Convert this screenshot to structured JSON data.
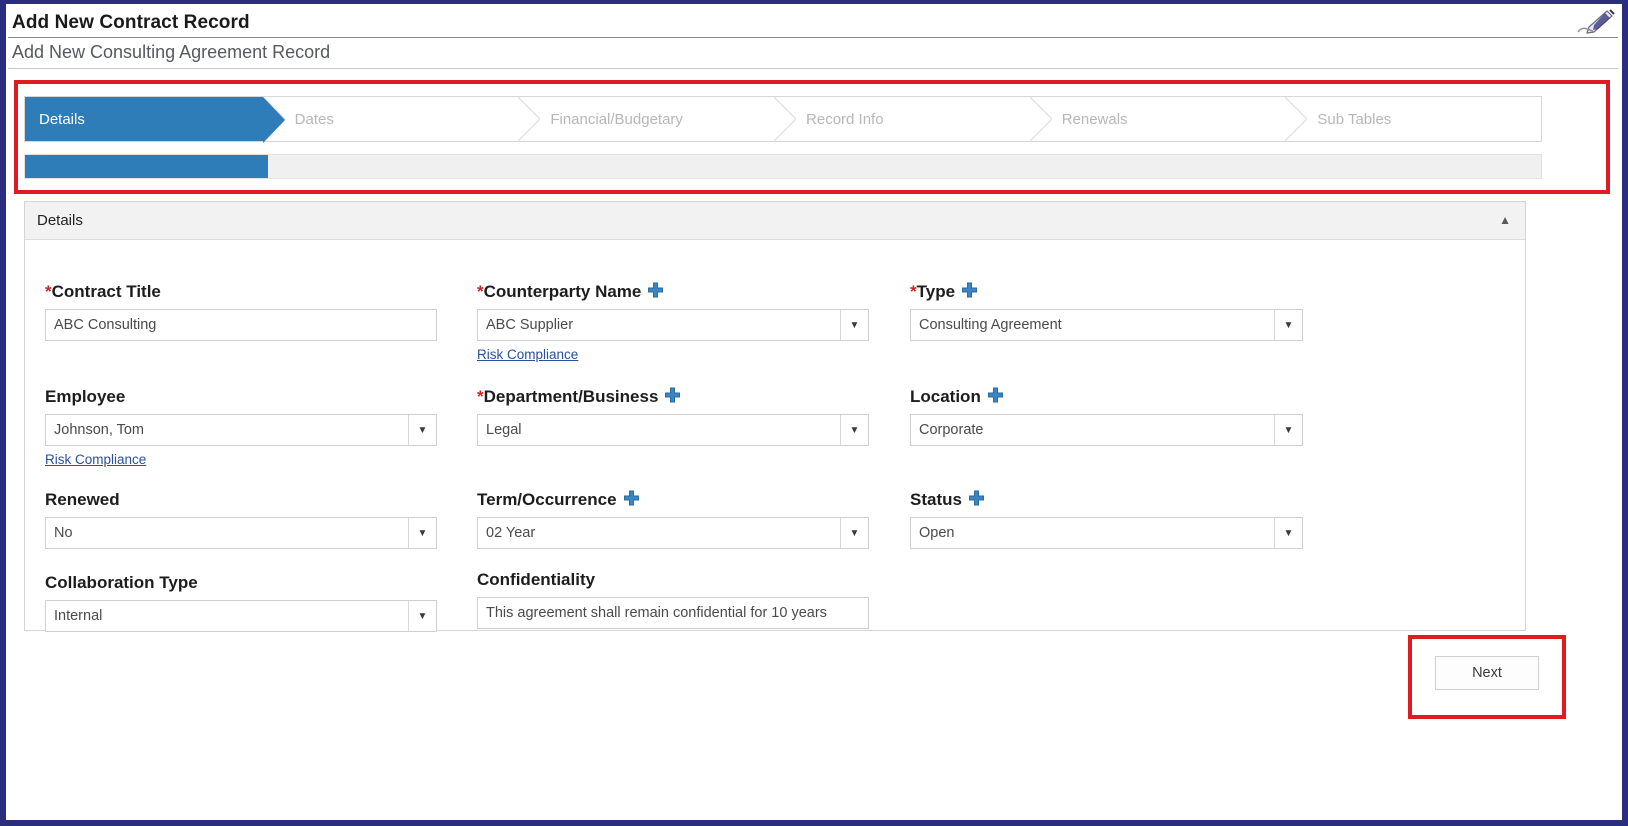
{
  "header": {
    "title": "Add New Contract Record",
    "subtitle": "Add New Consulting Agreement Record",
    "pen_icon": "pen-signature-icon"
  },
  "wizard": {
    "steps": [
      {
        "label": "Details",
        "active": true
      },
      {
        "label": "Dates",
        "active": false
      },
      {
        "label": "Financial/Budgetary",
        "active": false
      },
      {
        "label": "Record Info",
        "active": false
      },
      {
        "label": "Renewals",
        "active": false
      },
      {
        "label": "Sub Tables",
        "active": false
      }
    ],
    "progress_percent": 16,
    "active_color": "#2e7cb8",
    "inactive_text_color": "#b7b7b7"
  },
  "panel": {
    "title": "Details",
    "collapse_glyph": "▲"
  },
  "fields": {
    "contract_title": {
      "label": "Contract Title",
      "required": true,
      "has_plus": false,
      "value": "ABC Consulting",
      "type": "text"
    },
    "counterparty_name": {
      "label": "Counterparty Name",
      "required": true,
      "has_plus": true,
      "value": "ABC Supplier",
      "type": "select",
      "sublink": "Risk Compliance"
    },
    "type": {
      "label": "Type",
      "required": true,
      "has_plus": true,
      "value": "Consulting Agreement",
      "type": "select"
    },
    "employee": {
      "label": "Employee",
      "required": false,
      "has_plus": false,
      "value": "Johnson, Tom",
      "type": "select",
      "sublink": "Risk Compliance"
    },
    "department_business": {
      "label": "Department/Business",
      "required": true,
      "has_plus": true,
      "value": "Legal",
      "type": "select"
    },
    "location": {
      "label": "Location",
      "required": false,
      "has_plus": true,
      "value": "Corporate",
      "type": "select"
    },
    "renewed": {
      "label": "Renewed",
      "required": false,
      "has_plus": false,
      "value": "No",
      "type": "select"
    },
    "term_occurrence": {
      "label": "Term/Occurrence",
      "required": false,
      "has_plus": true,
      "value": "02 Year",
      "type": "select"
    },
    "status": {
      "label": "Status",
      "required": false,
      "has_plus": true,
      "value": "Open",
      "type": "select"
    },
    "collaboration_type": {
      "label": "Collaboration Type",
      "required": false,
      "has_plus": false,
      "value": "Internal",
      "type": "select"
    },
    "confidentiality": {
      "label": "Confidentiality",
      "required": false,
      "has_plus": false,
      "value": "This agreement shall remain confidential for 10 years",
      "type": "text"
    }
  },
  "footer": {
    "next_label": "Next"
  },
  "annotations": {
    "highlight_color": "#e01b24",
    "boxes": [
      "wizard-steps",
      "next-button"
    ]
  },
  "colors": {
    "window_border": "#2b2e7e",
    "accent_blue": "#2e7cb8",
    "required_red": "#d82020",
    "link_blue": "#2a4f9c"
  }
}
